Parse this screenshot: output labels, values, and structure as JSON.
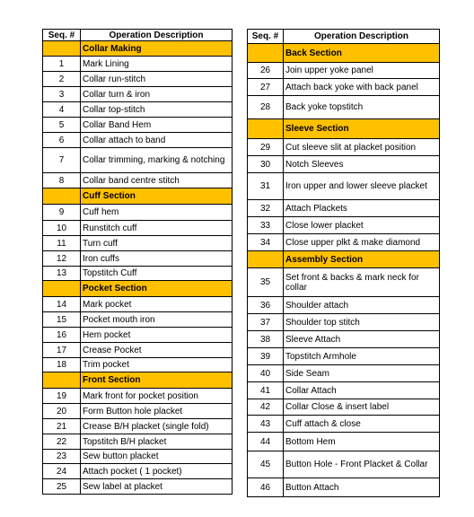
{
  "header": {
    "seq": "Seq. #",
    "desc": "Operation Description"
  },
  "colors": {
    "section_fill": "#FFC000",
    "border": "#000000"
  },
  "left_table": [
    {
      "type": "section",
      "label": "Collar Making"
    },
    {
      "type": "op",
      "seq": "1",
      "desc": "Mark Lining"
    },
    {
      "type": "op",
      "seq": "2",
      "desc": "Collar run-stitch"
    },
    {
      "type": "op",
      "seq": "3",
      "desc": "Collar turn & iron"
    },
    {
      "type": "op",
      "seq": "4",
      "desc": "Collar top-stitch"
    },
    {
      "type": "op",
      "seq": "5",
      "desc": " Collar Band Hem"
    },
    {
      "type": "op",
      "seq": "6",
      "desc": "Collar attach to band"
    },
    {
      "type": "op",
      "seq": "7",
      "desc": "Collar trimming, marking & notching"
    },
    {
      "type": "op",
      "seq": "8",
      "desc": "Collar band centre stitch"
    },
    {
      "type": "section",
      "label": "Cuff Section"
    },
    {
      "type": "op",
      "seq": "9",
      "desc": "Cuff hem"
    },
    {
      "type": "op",
      "seq": "10",
      "desc": "Runstitch cuff"
    },
    {
      "type": "op",
      "seq": "11",
      "desc": "Turn cuff"
    },
    {
      "type": "op",
      "seq": "12",
      "desc": "Iron cuffs"
    },
    {
      "type": "op",
      "seq": "13",
      "desc": "Topstitch Cuff"
    },
    {
      "type": "section",
      "label": "Pocket Section"
    },
    {
      "type": "op",
      "seq": "14",
      "desc": "Mark pocket"
    },
    {
      "type": "op",
      "seq": "15",
      "desc": "Pocket mouth iron"
    },
    {
      "type": "op",
      "seq": "16",
      "desc": "Hem pocket"
    },
    {
      "type": "op",
      "seq": "17",
      "desc": "Crease Pocket"
    },
    {
      "type": "op",
      "seq": "18",
      "desc": "Trim pocket"
    },
    {
      "type": "section",
      "label": "Front Section"
    },
    {
      "type": "op",
      "seq": "19",
      "desc": "Mark front for pocket position"
    },
    {
      "type": "op",
      "seq": "20",
      "desc": "Form Button hole placket"
    },
    {
      "type": "op",
      "seq": "21",
      "desc": "Crease B/H placket (single fold)"
    },
    {
      "type": "op",
      "seq": "22",
      "desc": "Topstitch B/H placket"
    },
    {
      "type": "op",
      "seq": "23",
      "desc": "Sew button placket"
    },
    {
      "type": "op",
      "seq": "24",
      "desc": "Attach pocket ( 1 pocket)"
    },
    {
      "type": "op",
      "seq": "25",
      "desc": "Sew label at placket"
    }
  ],
  "right_table": [
    {
      "type": "section",
      "label": "Back Section"
    },
    {
      "type": "op",
      "seq": "26",
      "desc": "Join upper yoke panel"
    },
    {
      "type": "op",
      "seq": "27",
      "desc": "Attach back yoke with back panel"
    },
    {
      "type": "op",
      "seq": "28",
      "desc": "Back yoke topstitch"
    },
    {
      "type": "section",
      "label": "Sleeve Section"
    },
    {
      "type": "op",
      "seq": "29",
      "desc": "Cut sleeve slit at placket position"
    },
    {
      "type": "op",
      "seq": "30",
      "desc": "Notch Sleeves"
    },
    {
      "type": "op",
      "seq": "31",
      "desc": "Iron upper and lower sleeve placket"
    },
    {
      "type": "op",
      "seq": "32",
      "desc": "Attach Plackets"
    },
    {
      "type": "op",
      "seq": "33",
      "desc": "Close lower placket"
    },
    {
      "type": "op",
      "seq": "34",
      "desc": "Close upper plkt & make diamond"
    },
    {
      "type": "section",
      "label": "Assembly Section"
    },
    {
      "type": "op",
      "seq": "35",
      "desc": "Set front & backs & mark neck for collar"
    },
    {
      "type": "op",
      "seq": "36",
      "desc": "Shoulder attach"
    },
    {
      "type": "op",
      "seq": "37",
      "desc": "Shoulder top stitch"
    },
    {
      "type": "op",
      "seq": "38",
      "desc": "Sleeve Attach"
    },
    {
      "type": "op",
      "seq": "39",
      "desc": "Topstitch Armhole"
    },
    {
      "type": "op",
      "seq": "40",
      "desc": "Side Seam"
    },
    {
      "type": "op",
      "seq": "41",
      "desc": "Collar Attach"
    },
    {
      "type": "op",
      "seq": "42",
      "desc": "Collar Close & insert label"
    },
    {
      "type": "op",
      "seq": "43",
      "desc": "Cuff attach & close"
    },
    {
      "type": "op",
      "seq": "44",
      "desc": "Bottom Hem"
    },
    {
      "type": "op",
      "seq": "45",
      "desc": "Button Hole  - Front Placket & Collar"
    },
    {
      "type": "op",
      "seq": "46",
      "desc": "Button Attach"
    }
  ]
}
